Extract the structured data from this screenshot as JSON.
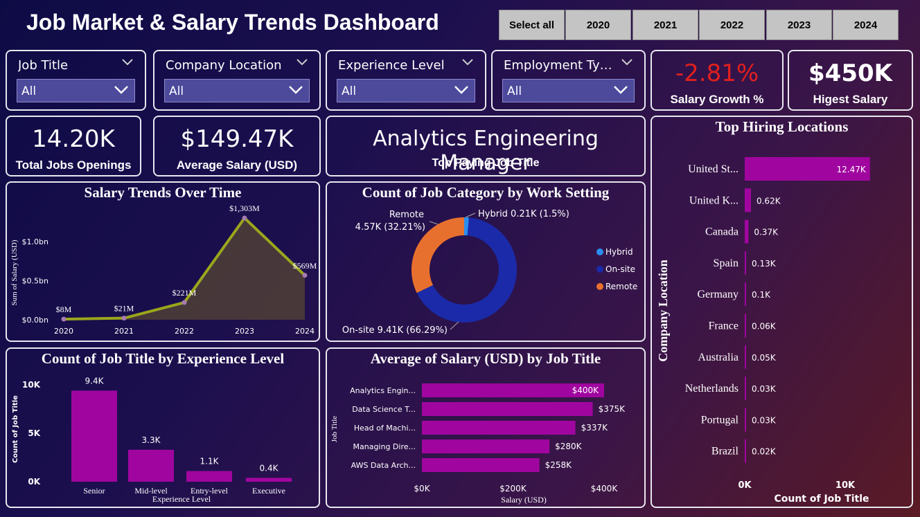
{
  "header": {
    "title": "Job Market & Salary Trends Dashboard"
  },
  "year_buttons": [
    "Select all",
    "2020",
    "2021",
    "2022",
    "2023",
    "2024"
  ],
  "slicers": [
    {
      "label": "Job Title",
      "value": "All"
    },
    {
      "label": "Company Location",
      "value": "All"
    },
    {
      "label": "Experience Level",
      "value": "All"
    },
    {
      "label": "Employment Ty…",
      "value": "All"
    }
  ],
  "kpis": {
    "salary_growth": {
      "value": "-2.81%",
      "label": "Salary Growth %",
      "color": "#e0201e"
    },
    "highest_salary": {
      "value": "$450K",
      "label": "Higest Salary"
    },
    "total_jobs": {
      "value": "14.20K",
      "label": "Total Jobs Openings"
    },
    "avg_salary": {
      "value": "$149.47K",
      "label": "Average Salary (USD)"
    },
    "top_title": {
      "value": "Analytics Engineering Manager",
      "label": "Top Paying Job Title"
    }
  },
  "colors": {
    "accent": "#a0069f",
    "line": "#9aa61c",
    "hybrid": "#2a8ef0",
    "onsite": "#1a2aa8",
    "remote": "#e8702e"
  },
  "chart_data": [
    {
      "id": "salary_trends",
      "type": "area",
      "title": "Salary Trends Over Time",
      "xlabel": "",
      "ylabel": "Sum of Salary (USD)",
      "x": [
        "2020",
        "2021",
        "2022",
        "2023",
        "2024"
      ],
      "values": [
        8,
        21,
        221,
        1303,
        569
      ],
      "value_unit": "millions USD",
      "data_labels": [
        "$8M",
        "$21M",
        "$221M",
        "$1,303M",
        "$569M"
      ],
      "y_ticks": [
        {
          "v": 0,
          "label": "$0.0bn"
        },
        {
          "v": 500,
          "label": "$0.5bn"
        },
        {
          "v": 1000,
          "label": "$1.0bn"
        }
      ],
      "ylim": [
        0,
        1303
      ]
    },
    {
      "id": "work_setting",
      "type": "pie",
      "title": "Count of Job Category by Work Setting",
      "slices": [
        {
          "name": "Hybrid",
          "value": 0.21,
          "label": "Hybrid 0.21K (1.5%)"
        },
        {
          "name": "On-site",
          "value": 9.41,
          "label": "On-site 9.41K (66.29%)"
        },
        {
          "name": "Remote",
          "value": 4.57,
          "label_line1": "Remote",
          "label_line2": "4.57K (32.21%)"
        }
      ],
      "legend": [
        "Hybrid",
        "On-site",
        "Remote"
      ],
      "legend_position": "right"
    },
    {
      "id": "experience",
      "type": "bar",
      "title": "Count of Job Title by Experience Level",
      "xlabel": "Experience Level",
      "ylabel": "Count of Job Title",
      "categories": [
        "Senior",
        "Mid-level",
        "Entry-level",
        "Executive"
      ],
      "values": [
        9.4,
        3.3,
        1.1,
        0.4
      ],
      "data_labels": [
        "9.4K",
        "3.3K",
        "1.1K",
        "0.4K"
      ],
      "y_ticks": [
        {
          "v": 0,
          "label": "0K"
        },
        {
          "v": 5,
          "label": "5K"
        },
        {
          "v": 10,
          "label": "10K"
        }
      ],
      "ylim": [
        0,
        10
      ]
    },
    {
      "id": "salary_by_title",
      "type": "bar",
      "orientation": "horizontal",
      "title": "Average of Salary (USD) by Job Title",
      "xlabel": "Salary (USD)",
      "ylabel": "Job Title",
      "categories": [
        "Analytics Engin...",
        "Data Science T...",
        "Head of Machi...",
        "Managing Dire...",
        "AWS Data Arch..."
      ],
      "values": [
        400,
        375,
        337,
        280,
        258
      ],
      "data_labels": [
        "$400K",
        "$375K",
        "$337K",
        "$280K",
        "$258K"
      ],
      "x_ticks": [
        {
          "v": 0,
          "label": "$0K"
        },
        {
          "v": 200,
          "label": "$200K"
        },
        {
          "v": 400,
          "label": "$400K"
        }
      ],
      "xlim": [
        0,
        400
      ]
    },
    {
      "id": "top_locations",
      "type": "bar",
      "orientation": "horizontal",
      "title": "Top Hiring Locations",
      "xlabel": "Count of Job Title",
      "ylabel": "Company Location",
      "categories": [
        "United St...",
        "United K...",
        "Canada",
        "Spain",
        "Germany",
        "France",
        "Australia",
        "Netherlands",
        "Portugal",
        "Brazil"
      ],
      "values": [
        12.47,
        0.62,
        0.37,
        0.13,
        0.1,
        0.06,
        0.05,
        0.03,
        0.03,
        0.02
      ],
      "data_labels": [
        "12.47K",
        "0.62K",
        "0.37K",
        "0.13K",
        "0.1K",
        "0.06K",
        "0.05K",
        "0.03K",
        "0.03K",
        "0.02K"
      ],
      "x_ticks": [
        {
          "v": 0,
          "label": "0K"
        },
        {
          "v": 10,
          "label": "10K"
        }
      ],
      "xlim": [
        0,
        10
      ]
    }
  ]
}
